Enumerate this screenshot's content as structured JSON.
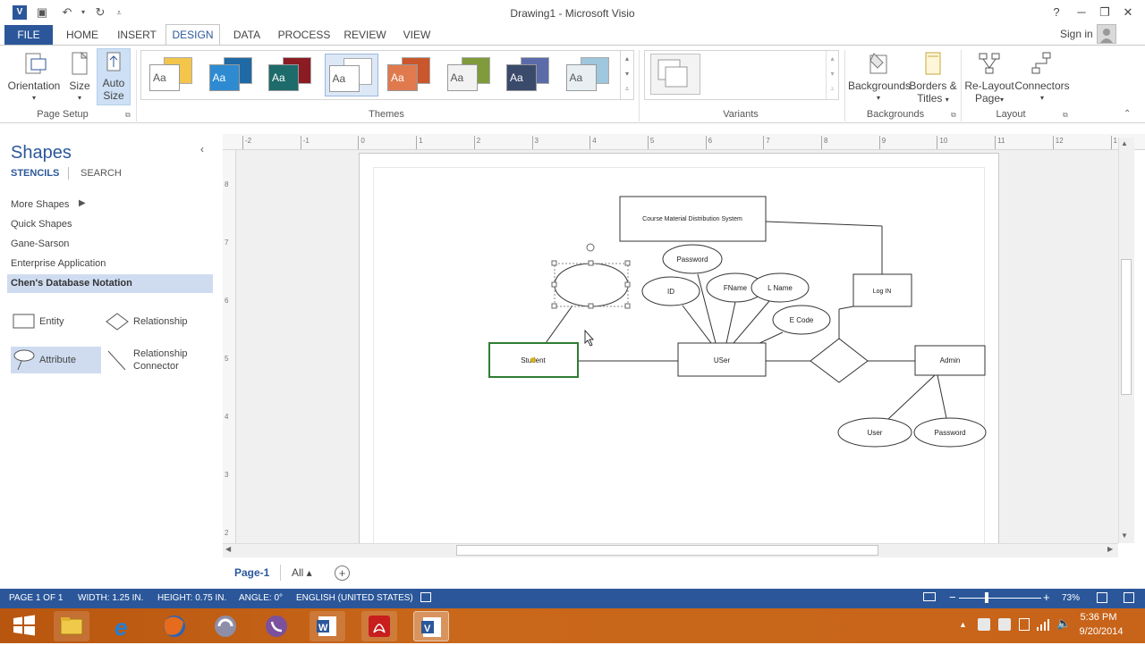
{
  "window": {
    "title": "Drawing1 - Microsoft Visio",
    "help": "?",
    "sign_in": "Sign in"
  },
  "tabs": [
    {
      "label": "FILE"
    },
    {
      "label": "HOME"
    },
    {
      "label": "INSERT"
    },
    {
      "label": "DESIGN"
    },
    {
      "label": "DATA"
    },
    {
      "label": "PROCESS"
    },
    {
      "label": "REVIEW"
    },
    {
      "label": "VIEW"
    }
  ],
  "ribbon": {
    "page_setup": {
      "orientation": "Orientation",
      "size": "Size",
      "auto": "Auto",
      "size2": "Size",
      "label": "Page Setup"
    },
    "themes": {
      "label": "Themes",
      "aa": "Aa",
      "items": [
        {
          "back": "#f3c54b",
          "front": "#ffffff"
        },
        {
          "back": "#1f6aa5",
          "front": "#2e8bd1"
        },
        {
          "back": "#8b1c24",
          "front": "#1e6b6b"
        },
        {
          "back": "#ffffff",
          "front": "#ffffff"
        },
        {
          "back": "#c9562c",
          "front": "#e07a4e"
        },
        {
          "back": "#7f9b3b",
          "front": "#f2f2f2"
        },
        {
          "back": "#5b6aa8",
          "front": "#3a4a6b"
        },
        {
          "back": "#9ec6dc",
          "front": "#e8eff3"
        }
      ]
    },
    "variants": {
      "label": "Variants"
    },
    "backgrounds": {
      "bg": "Backgrounds",
      "borders": "Borders &",
      "titles": "Titles",
      "label": "Backgrounds"
    },
    "layout": {
      "relayout": "Re-Layout",
      "page": "Page",
      "connectors": "Connectors",
      "label": "Layout"
    }
  },
  "shapes_pane": {
    "title": "Shapes",
    "stencils": "STENCILS",
    "search": "SEARCH",
    "items": [
      "More Shapes",
      "Quick Shapes",
      "Gane-Sarson",
      "Enterprise Application",
      "Chen's Database Notation"
    ],
    "masters": {
      "entity": "Entity",
      "relationship": "Relationship",
      "attribute": "Attribute",
      "rel_connector_1": "Relationship",
      "rel_connector_2": "Connector"
    }
  },
  "ruler": {
    "h": [
      "-2",
      "-1",
      "0",
      "1",
      "2",
      "3",
      "4",
      "5",
      "6",
      "7",
      "8",
      "9",
      "10",
      "11",
      "12",
      "1"
    ],
    "v": [
      "8",
      "7",
      "6",
      "5",
      "4",
      "3",
      "2"
    ]
  },
  "diagram": {
    "cmds": "Course Material Distribution System",
    "password": "Password",
    "id": "ID",
    "fname": "FName",
    "lname": "L Name",
    "ecode": "E Code",
    "login": "Log IN",
    "student": "Student",
    "user": "USer",
    "admin": "Admin",
    "user2": "User",
    "password2": "Password"
  },
  "page_tabs": {
    "page": "Page-1",
    "all": "All ▴"
  },
  "status": {
    "page": "PAGE 1 OF 1",
    "width": "WIDTH: 1.25 IN.",
    "height": "HEIGHT: 0.75 IN.",
    "angle": "ANGLE: 0°",
    "lang": "ENGLISH (UNITED STATES)",
    "zoom": "73%"
  },
  "taskbar": {
    "time": "5:36 PM",
    "date": "9/20/2014"
  }
}
